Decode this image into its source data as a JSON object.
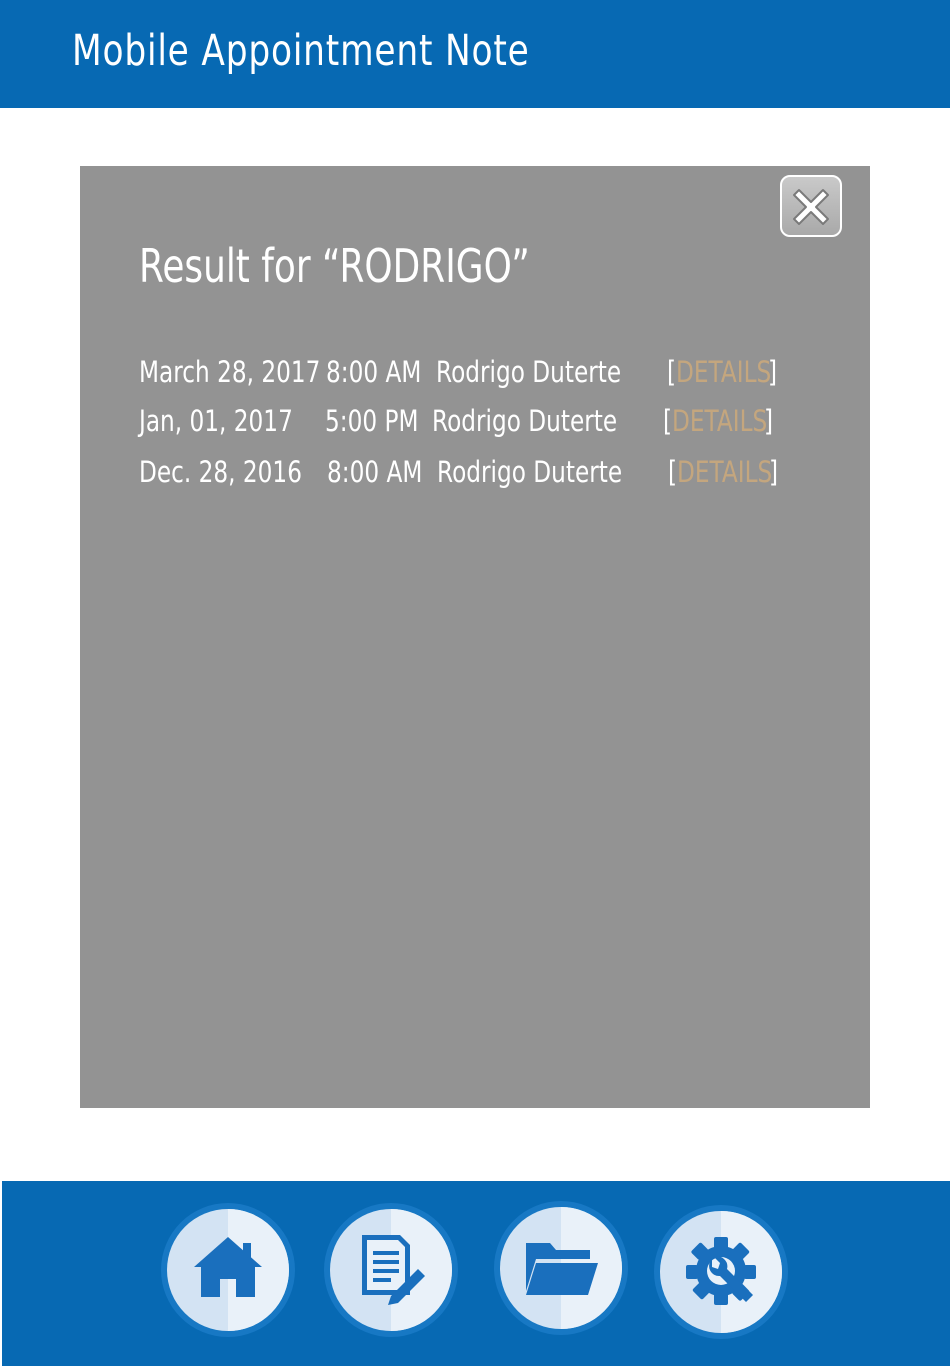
{
  "header": {
    "title": "Mobile Appointment Note"
  },
  "panel": {
    "title": "Result for “RODRIGO”",
    "results": [
      {
        "date": "March 28, 2017",
        "time": "8:00 AM",
        "name": "Rodrigo Duterte",
        "bracket_open": "[",
        "link": "DETAILS",
        "bracket_close": "]"
      },
      {
        "date": "Jan, 01, 2017",
        "time": "5:00 PM",
        "name": "Rodrigo Duterte",
        "bracket_open": "[",
        "link": "DETAILS",
        "bracket_close": "]"
      },
      {
        "date": "Dec. 28, 2016",
        "time": "8:00 AM",
        "name": "Rodrigo Duterte",
        "bracket_open": "[",
        "link": "DETAILS",
        "bracket_close": "]"
      }
    ]
  },
  "icons": {
    "close": "close-icon",
    "nav": [
      "home-icon",
      "notes-icon",
      "folder-icon",
      "settings-icon"
    ]
  },
  "colors": {
    "primary": "#0769b3",
    "panel": "#939393",
    "link": "#c4a67e",
    "icon": "#1a6fbd"
  }
}
